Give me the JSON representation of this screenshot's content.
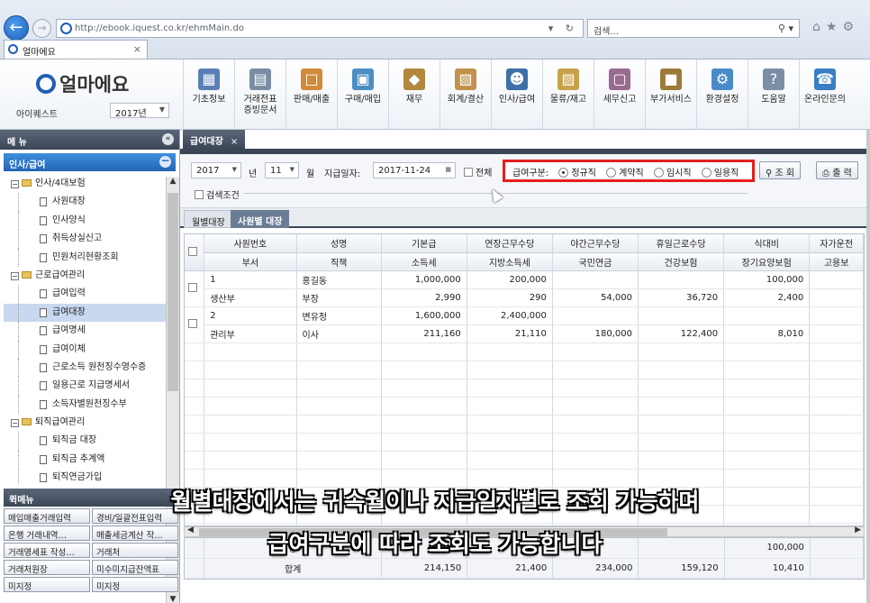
{
  "browser": {
    "url": "http://ebook.iquest.co.kr/ehmMain.do",
    "search_placeholder": "검색...",
    "tab_title": "얼마에요"
  },
  "header": {
    "logo": "얼마에요",
    "company": "아이퀘스트",
    "year": "2017년",
    "toolbar": [
      {
        "label": "기초정보",
        "icon": "basic-info-icon",
        "color": "#5a7fb5"
      },
      {
        "label": "거래전표\n증빙문서",
        "icon": "voucher-icon",
        "color": "#7a8da3"
      },
      {
        "label": "판매/매출",
        "icon": "sales-icon",
        "color": "#d08a3a"
      },
      {
        "label": "구매/매입",
        "icon": "purchase-icon",
        "color": "#4d8ec2"
      },
      {
        "label": "재무",
        "icon": "finance-icon",
        "color": "#b0883e"
      },
      {
        "label": "회계/결산",
        "icon": "accounting-icon",
        "color": "#c2914a"
      },
      {
        "label": "인사/급여",
        "icon": "hr-payroll-icon",
        "color": "#3e6fa8"
      },
      {
        "label": "물류/재고",
        "icon": "logistics-icon",
        "color": "#c8a24a"
      },
      {
        "label": "세무신고",
        "icon": "tax-icon",
        "color": "#9a6b8f"
      },
      {
        "label": "부가서비스",
        "icon": "service-icon",
        "color": "#9c7a3a"
      },
      {
        "label": "환경설정",
        "icon": "settings-icon",
        "color": "#4a8ac9"
      },
      {
        "label": "도움말",
        "icon": "help-icon",
        "color": "#7c8ea6"
      },
      {
        "label": "온라인문의",
        "icon": "online-inquiry-icon",
        "color": "#3a7ec4"
      }
    ]
  },
  "sidebar": {
    "title": "메 뉴",
    "section": "인사/급여",
    "tree": [
      {
        "type": "folder",
        "label": "인사/4대보험"
      },
      {
        "type": "leaf",
        "label": "사원대장"
      },
      {
        "type": "leaf",
        "label": "인사양식"
      },
      {
        "type": "leaf",
        "label": "취득상실신고"
      },
      {
        "type": "leaf",
        "label": "민원처리현황조회"
      },
      {
        "type": "folder",
        "label": "근로급여관리"
      },
      {
        "type": "leaf",
        "label": "급여입력"
      },
      {
        "type": "leaf",
        "label": "급여대장",
        "selected": true
      },
      {
        "type": "leaf",
        "label": "급여명세"
      },
      {
        "type": "leaf",
        "label": "급여이체"
      },
      {
        "type": "leaf",
        "label": "근로소득 원천징수영수증"
      },
      {
        "type": "leaf",
        "label": "일용근로 지급명세서"
      },
      {
        "type": "leaf",
        "label": "소득자별원천징수부"
      },
      {
        "type": "folder",
        "label": "퇴직급여관리"
      },
      {
        "type": "leaf",
        "label": "퇴직금 대장"
      },
      {
        "type": "leaf",
        "label": "퇴직금 추계액"
      },
      {
        "type": "leaf",
        "label": "퇴직연금가입"
      }
    ],
    "quick_title": "퀵메뉴",
    "quick": [
      "매입매출거래입력",
      "경비/일괄전표입력",
      "은행 거래내역…",
      "매출세금계산 작…",
      "거래명세표 작성…",
      "거래처",
      "거래처원장",
      "미수미지급잔액표",
      "미지정",
      "미지정"
    ]
  },
  "main": {
    "tab": "급여대장",
    "filter": {
      "year": "2017",
      "year_unit": "년",
      "month": "11",
      "month_unit": "월",
      "pay_date_label": "지급일자:",
      "pay_date": "2017-11-24",
      "all_label": "전체",
      "type_label": "급여구분:",
      "types": [
        "정규직",
        "계약직",
        "임시직",
        "일용직"
      ],
      "selected_type": "정규직",
      "search_cond": "검색조건",
      "btn_search": "조 회",
      "btn_print": "출 력"
    },
    "subtabs": [
      "월별대장",
      "사원별 대장"
    ],
    "columns_top": [
      "사원번호",
      "성명",
      "기본급",
      "연장근무수당",
      "야간근무수당",
      "휴일근로수당",
      "식대비",
      "자가운전"
    ],
    "columns_bottom": [
      "부서",
      "직책",
      "소득세",
      "지방소득세",
      "국민연금",
      "건강보험",
      "장기요양보험",
      "고용보"
    ],
    "rows": [
      {
        "top": [
          "1",
          "홍길동",
          "1,000,000",
          "200,000",
          "",
          "",
          "100,000",
          ""
        ],
        "bottom": [
          "생산부",
          "부장",
          "2,990",
          "290",
          "54,000",
          "36,720",
          "2,400",
          ""
        ]
      },
      {
        "top": [
          "2",
          "변유정",
          "1,600,000",
          "2,400,000",
          "",
          "",
          "",
          ""
        ],
        "bottom": [
          "관리부",
          "이사",
          "211,160",
          "21,110",
          "180,000",
          "122,400",
          "8,010",
          ""
        ]
      }
    ],
    "totals": {
      "label_top": "총",
      "top": [
        "",
        "",
        "",
        "",
        "",
        "",
        "100,000",
        ""
      ],
      "label_bottom": "합계",
      "bottom": [
        "",
        "",
        "214,150",
        "21,400",
        "234,000",
        "159,120",
        "10,410",
        ""
      ]
    }
  },
  "subtitle": {
    "line1": "월별대장에서는 귀속월이나 지급일자별로 조회 가능하며",
    "line2": "급여구분에 따라 조회도 가능합니다"
  }
}
